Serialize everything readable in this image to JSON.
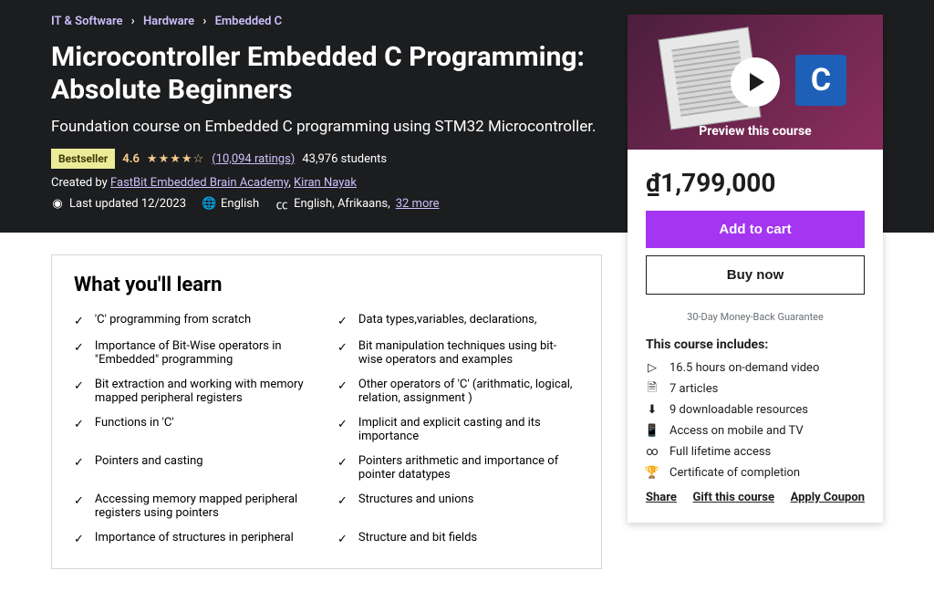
{
  "breadcrumb": [
    "IT & Software",
    "Hardware",
    "Embedded C"
  ],
  "title": "Microcontroller Embedded C Programming: Absolute Beginners",
  "subtitle": "Foundation course on Embedded C programming using STM32 Microcontroller.",
  "bestseller": "Bestseller",
  "rating": "4.6",
  "rating_count": "(10,094 ratings)",
  "students": "43,976 students",
  "created_by_label": "Created by",
  "authors": [
    "FastBit Embedded Brain Academy",
    "Kiran Nayak"
  ],
  "last_updated": "Last updated 12/2023",
  "language": "English",
  "captions": "English, Afrikaans,",
  "captions_more": "32 more",
  "preview_label": "Preview this course",
  "price": "₫1,799,000",
  "add_to_cart": "Add to cart",
  "buy_now": "Buy now",
  "guarantee": "30-Day Money-Back Guarantee",
  "includes_title": "This course includes:",
  "includes": [
    {
      "icon": "video",
      "text": "16.5 hours on-demand video"
    },
    {
      "icon": "file",
      "text": "7 articles"
    },
    {
      "icon": "download",
      "text": "9 downloadable resources"
    },
    {
      "icon": "mobile",
      "text": "Access on mobile and TV"
    },
    {
      "icon": "infinity",
      "text": "Full lifetime access"
    },
    {
      "icon": "trophy",
      "text": "Certificate of completion"
    }
  ],
  "actions": [
    "Share",
    "Gift this course",
    "Apply Coupon"
  ],
  "learn_title": "What you'll learn",
  "learn_items_col1": [
    "'C' programming from scratch",
    "Importance of Bit-Wise operators in \"Embedded\" programming",
    "Bit extraction and working with memory mapped peripheral registers",
    "Functions in 'C'",
    "Pointers and casting",
    "Accessing memory mapped peripheral registers using pointers",
    "Importance of structures in peripheral"
  ],
  "learn_items_col2": [
    "Data types,variables, declarations,",
    "Bit manipulation techniques using bit-wise operators and examples",
    "Other operators of 'C' (arithmatic, logical, relation, assignment )",
    "Implicit and explicit casting and its importance",
    "Pointers arithmetic and importance of pointer datatypes",
    "Structures and unions",
    "Structure and bit fields"
  ]
}
